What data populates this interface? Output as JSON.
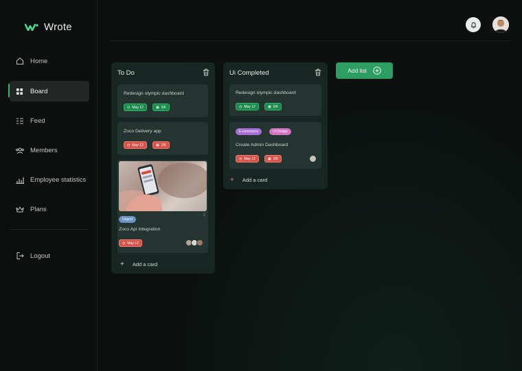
{
  "app": {
    "name": "Wrote",
    "brand_color": "#3fb16f"
  },
  "sidebar": {
    "items": [
      {
        "label": "Home",
        "icon": "home-icon"
      },
      {
        "label": "Board",
        "icon": "grid-icon",
        "active": true
      },
      {
        "label": "Feed",
        "icon": "feed-icon"
      },
      {
        "label": "Members",
        "icon": "members-icon"
      },
      {
        "label": "Employee statistics",
        "icon": "chart-icon"
      },
      {
        "label": "Plans",
        "icon": "crown-icon"
      }
    ],
    "logout": "Logout"
  },
  "header": {
    "bell_icon": "bell-icon",
    "avatar": "user-avatar"
  },
  "lists": [
    {
      "title": "To Do",
      "cards": [
        {
          "title": "Redesign olympic dashboard",
          "date": "May 12",
          "checklist": "6/6",
          "status": "green"
        },
        {
          "title": "Zoco Delivery app",
          "date": "May 12",
          "checklist": "2/6",
          "status": "red"
        },
        {
          "title": "Zoco Api Integration",
          "tag": "Urgent",
          "date": "May 12",
          "comments": "2",
          "status": "red"
        }
      ],
      "add_card": "Add a card"
    },
    {
      "title": "Ui Completed",
      "cards": [
        {
          "title": "Redesign olympic dashboard",
          "date": "May 12",
          "checklist": "6/6",
          "status": "green"
        },
        {
          "title": "Create Admin Dashboard",
          "tags": [
            "E-commerce",
            "Ui Design"
          ],
          "date": "May 12",
          "checklist": "2/6",
          "status": "red"
        }
      ],
      "add_card": "Add a card"
    }
  ],
  "add_list": "Add list"
}
